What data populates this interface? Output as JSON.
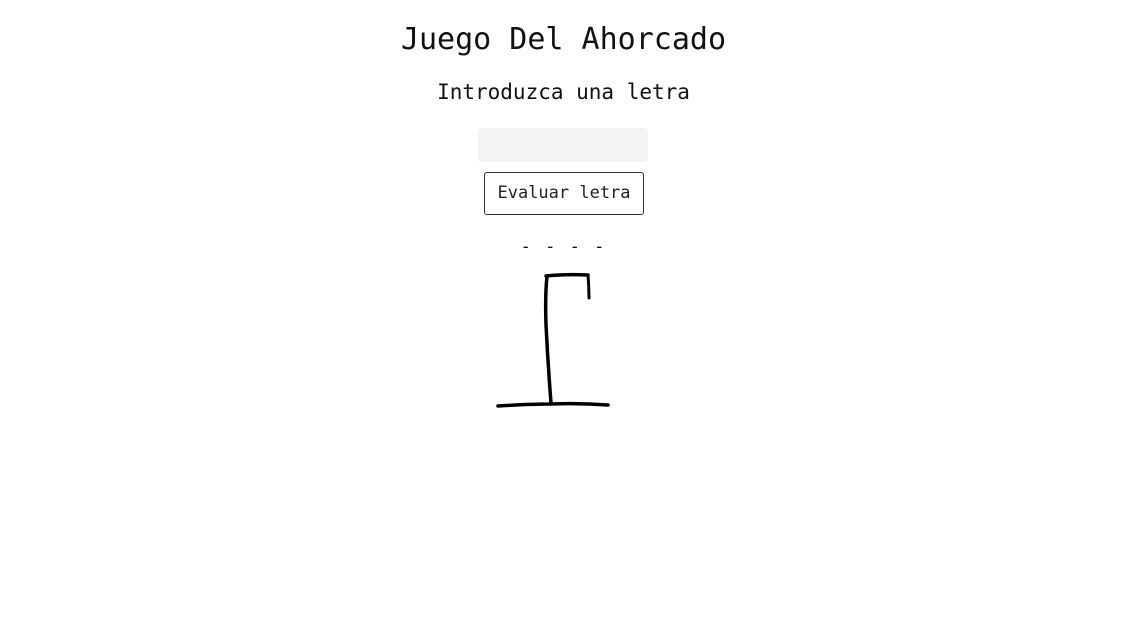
{
  "header": {
    "title": "Juego Del Ahorcado",
    "subtitle": "Introduzca una letra"
  },
  "form": {
    "input_value": "",
    "button_label": "Evaluar letra"
  },
  "game": {
    "word_display": "- - - -",
    "hangman_drawing": "gallows-only"
  },
  "colors": {
    "input_background": "#f3f3f3",
    "drawing_stroke": "#000000",
    "button_border": "#333333"
  }
}
